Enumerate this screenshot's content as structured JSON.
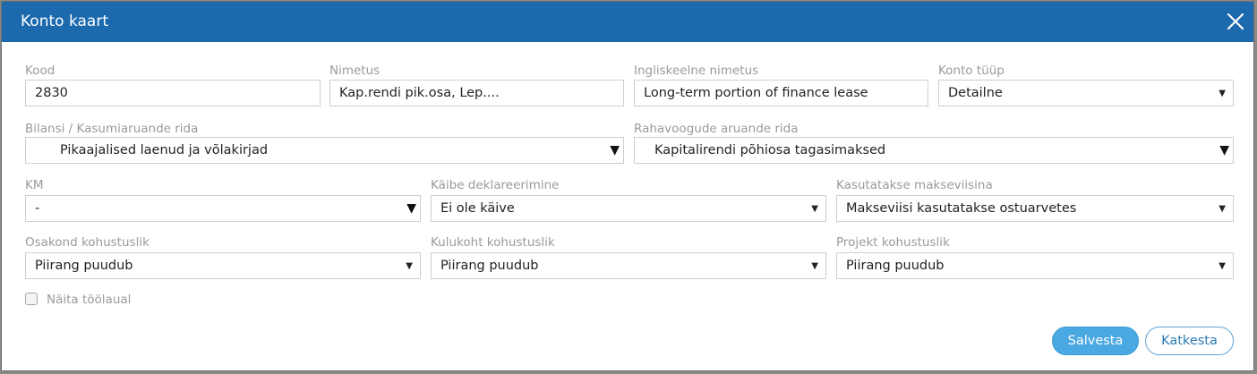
{
  "dialog": {
    "title": "Konto kaart",
    "close_icon": "close-icon"
  },
  "fields": {
    "kood": {
      "label": "Kood",
      "value": "2830"
    },
    "nimetus": {
      "label": "Nimetus",
      "value": "Kap.rendi pik.osa, Lep...."
    },
    "ingliskeelne": {
      "label": "Ingliskeelne nimetus",
      "value": "Long-term portion of finance lease"
    },
    "konto_tyyp": {
      "label": "Konto tüüp",
      "value": "Detailne"
    },
    "bilansi": {
      "label": "Bilansi / Kasumiaruande rida",
      "value": "Pikaajalised laenud ja võlakirjad"
    },
    "rahavoogude": {
      "label": "Rahavoogude aruande rida",
      "value": "Kapitalirendi põhiosa tagasimaksed"
    },
    "km": {
      "label": "KM",
      "value": "-"
    },
    "kaibe": {
      "label": "Käibe deklareerimine",
      "value": "Ei ole käive"
    },
    "makseviis": {
      "label": "Kasutatakse makseviisina",
      "value": "Makseviisi kasutatakse ostuarvetes"
    },
    "osakond": {
      "label": "Osakond kohustuslik",
      "value": "Piirang puudub"
    },
    "kulukoht": {
      "label": "Kulukoht kohustuslik",
      "value": "Piirang puudub"
    },
    "projekt": {
      "label": "Projekt kohustuslik",
      "value": "Piirang puudub"
    }
  },
  "checkbox": {
    "label": "Näita töölaual",
    "checked": false
  },
  "buttons": {
    "save": "Salvesta",
    "cancel": "Katkesta"
  },
  "icons": {
    "select_arrow": "▼"
  },
  "colors": {
    "titlebar": "#1c69ad",
    "save_button": "#4aa8e2",
    "label": "#9a9a9a"
  }
}
